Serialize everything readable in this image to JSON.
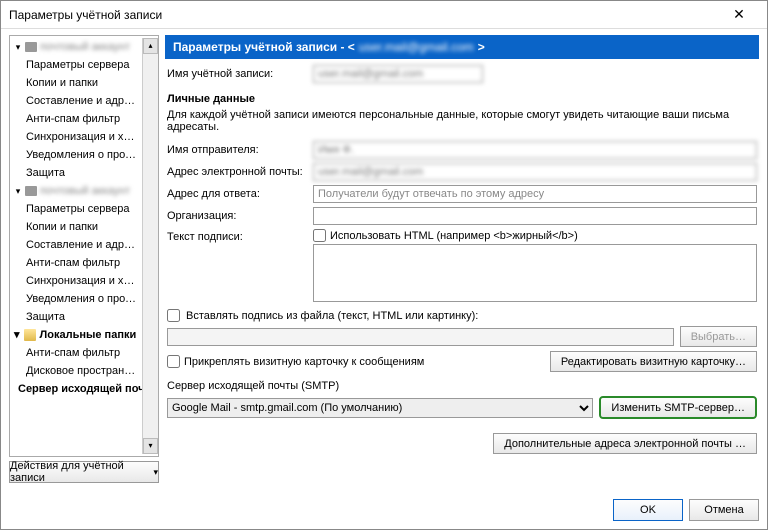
{
  "window": {
    "title": "Параметры учётной записи",
    "close": "✕"
  },
  "sidebar": {
    "account1": {
      "label": "почтовый аккаунт",
      "items": [
        "Параметры сервера",
        "Копии и папки",
        "Составление и адресация",
        "Анти-спам фильтр",
        "Синхронизация и хранение",
        "Уведомления о прочтении",
        "Защита"
      ]
    },
    "account2": {
      "label": "почтовый аккаунт",
      "items": [
        "Параметры сервера",
        "Копии и папки",
        "Составление и адресация",
        "Анти-спам фильтр",
        "Синхронизация и хранение",
        "Уведомления о прочтении",
        "Защита"
      ]
    },
    "localFolders": {
      "label": "Локальные папки",
      "items": [
        "Анти-спам фильтр",
        "Дисковое пространство"
      ]
    },
    "smtpServers": "Сервер исходящей поч…",
    "accountActions": "Действия для учётной записи"
  },
  "banner": {
    "prefix": "Параметры учётной записи - <",
    "email": "user.mail@gmail.com",
    "suffix": ">"
  },
  "form": {
    "accountNameLabel": "Имя учётной записи:",
    "accountNameValue": "user.mail@gmail.com",
    "personalSection": "Личные данные",
    "personalDesc": "Для каждой учётной записи имеются персональные данные, которые смогут увидеть читающие ваши письма адресаты.",
    "senderNameLabel": "Имя отправителя:",
    "senderNameValue": "Имя Ф.",
    "emailLabel": "Адрес электронной почты:",
    "emailValue": "user.mail@gmail.com",
    "replyLabel": "Адрес для ответа:",
    "replyPlaceholder": "Получатели будут отвечать по этому адресу",
    "orgLabel": "Организация:",
    "sigLabel": "Текст подписи:",
    "sigHtmlCheckbox": "Использовать HTML (например <b>жирный</b>)",
    "sigFileCheckbox": "Вставлять подпись из файла (текст, HTML или картинку):",
    "browseBtn": "Выбрать…",
    "vcardCheckbox": "Прикреплять визитную карточку к сообщениям",
    "vcardEditBtn": "Редактировать визитную карточку…",
    "smtpLabel": "Сервер исходящей почты (SMTP)",
    "smtpValue": "Google Mail - smtp.gmail.com (По умолчанию)",
    "smtpEditBtn": "Изменить SMTP-сервер…",
    "extraAddrBtn": "Дополнительные адреса электронной почты …"
  },
  "footer": {
    "ok": "OK",
    "cancel": "Отмена"
  }
}
